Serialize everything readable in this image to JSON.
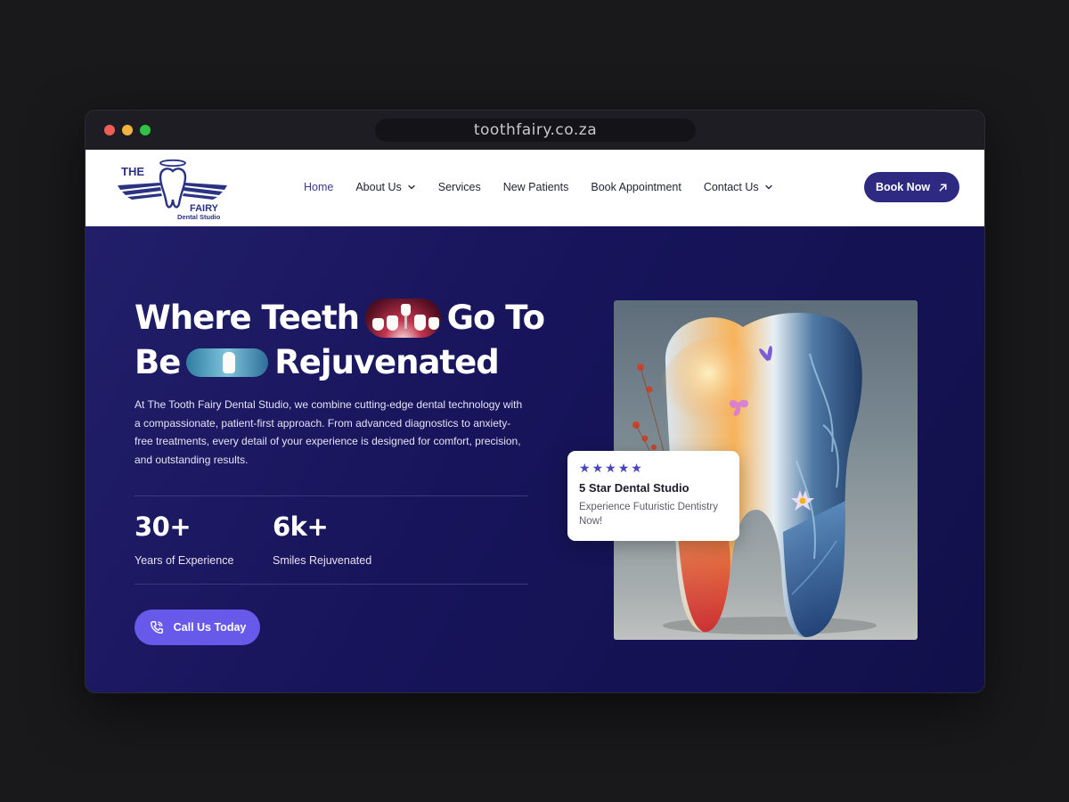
{
  "browser": {
    "url": "toothfairy.co.za"
  },
  "brand": {
    "logo_the": "THE",
    "logo_fairy": "FAIRY",
    "logo_sub": "Dental Studio"
  },
  "nav": {
    "items": [
      {
        "label": "Home",
        "active": true,
        "dropdown": false
      },
      {
        "label": "About Us",
        "active": false,
        "dropdown": true
      },
      {
        "label": "Services",
        "active": false,
        "dropdown": false
      },
      {
        "label": "New Patients",
        "active": false,
        "dropdown": false
      },
      {
        "label": "Book Appointment",
        "active": false,
        "dropdown": false
      },
      {
        "label": "Contact Us",
        "active": false,
        "dropdown": true
      }
    ],
    "cta": "Book Now",
    "cta_icon": "arrow-up-right-icon"
  },
  "hero": {
    "headline_part1": "Where Teeth",
    "headline_part2": "Go To",
    "headline_part3": "Be",
    "headline_part4": "Rejuvenated",
    "intro": "At The Tooth Fairy Dental Studio, we combine cutting-edge dental technology with a compassionate, patient-first approach. From advanced diagnostics to anxiety-free treatments, every detail of your experience is designed for comfort, precision, and outstanding results.",
    "stats": [
      {
        "value": "30+",
        "label": "Years of Experience"
      },
      {
        "value": "6k+",
        "label": "Smiles Rejuvenated"
      }
    ],
    "cta": "Call Us Today",
    "cta_icon": "phone-icon"
  },
  "review_card": {
    "stars": 5,
    "title": "5 Star Dental Studio",
    "text": "Experience Futuristic Dentistry Now!"
  },
  "colors": {
    "hero_bg": "#17145b",
    "primary": "#2e2a82",
    "accent": "#6759ea",
    "star": "#4b43b8"
  }
}
